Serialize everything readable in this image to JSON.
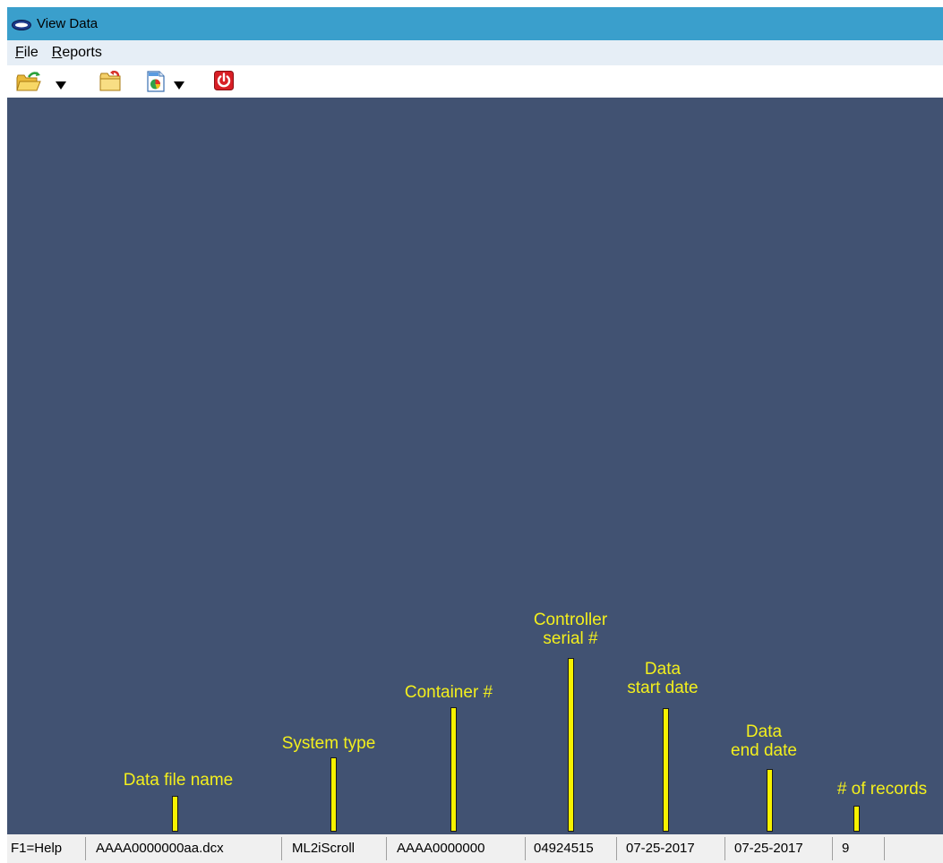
{
  "window": {
    "title": "View Data"
  },
  "menu": [
    {
      "label": "File",
      "ul": "F",
      "rest": "ile"
    },
    {
      "label": "Reports",
      "ul": "R",
      "rest": "eports"
    }
  ],
  "toolbar": {
    "buttons": [
      "open-folder-icon",
      "dropdown-arrow-icon",
      "close-folder-icon",
      "report-icon",
      "dropdown-arrow-icon",
      "power-icon"
    ]
  },
  "annotations": {
    "data_file_name": "Data file name",
    "system_type": "System type",
    "container": "Container #",
    "controller_line1": "Controller",
    "controller_line2": "serial #",
    "start_line1": "Data",
    "start_line2": "start date",
    "end_line1": "Data",
    "end_line2": "end date",
    "records": "# of records"
  },
  "status": {
    "help": "F1=Help",
    "file_name": "AAAA0000000aa.dcx",
    "system_type": "ML2iScroll",
    "container": "AAAA0000000",
    "serial": "04924515",
    "start_date": "07-25-2017",
    "end_date": "07-25-2017",
    "records": "9"
  },
  "colors": {
    "titlebar": "#3a9fcc",
    "menubar": "#e6eef6",
    "main_bg": "#415272",
    "annotation": "#f3ef1d",
    "statusbar": "#f0f0f0"
  }
}
